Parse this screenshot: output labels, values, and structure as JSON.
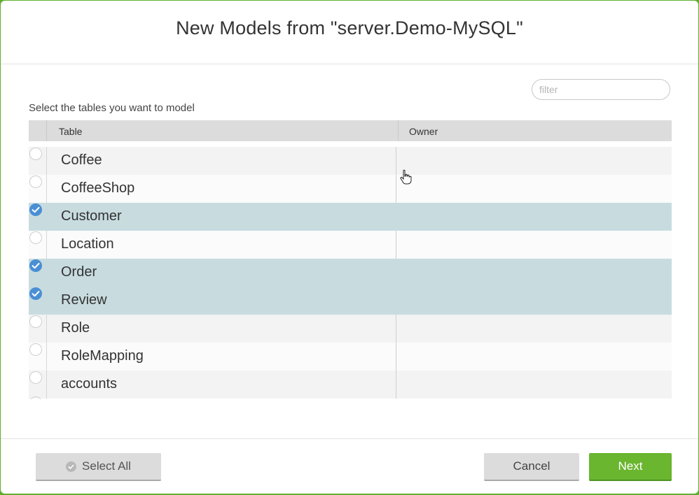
{
  "dialog": {
    "title": "New Models from \"server.Demo-MySQL\""
  },
  "filter": {
    "placeholder": "filter",
    "value": ""
  },
  "instruction": "Select the tables you want to model",
  "table": {
    "columns": {
      "table": "Table",
      "owner": "Owner"
    },
    "rows": [
      {
        "name": "Coffee",
        "owner": "",
        "selected": false
      },
      {
        "name": "CoffeeShop",
        "owner": "",
        "selected": false
      },
      {
        "name": "Customer",
        "owner": "",
        "selected": true
      },
      {
        "name": "Location",
        "owner": "",
        "selected": false
      },
      {
        "name": "Order",
        "owner": "",
        "selected": true
      },
      {
        "name": "Review",
        "owner": "",
        "selected": true
      },
      {
        "name": "Role",
        "owner": "",
        "selected": false
      },
      {
        "name": "RoleMapping",
        "owner": "",
        "selected": false
      },
      {
        "name": "accounts",
        "owner": "",
        "selected": false
      }
    ]
  },
  "buttons": {
    "select_all": "Select All",
    "cancel": "Cancel",
    "next": "Next"
  },
  "colors": {
    "accent_green": "#6ab62f",
    "selected_row": "#c8dce0",
    "check_blue": "#4a8fd4"
  },
  "icons": {
    "row_check": "check-circle-icon",
    "select_all": "check-circle-icon",
    "cursor": "hand-cursor-icon"
  }
}
